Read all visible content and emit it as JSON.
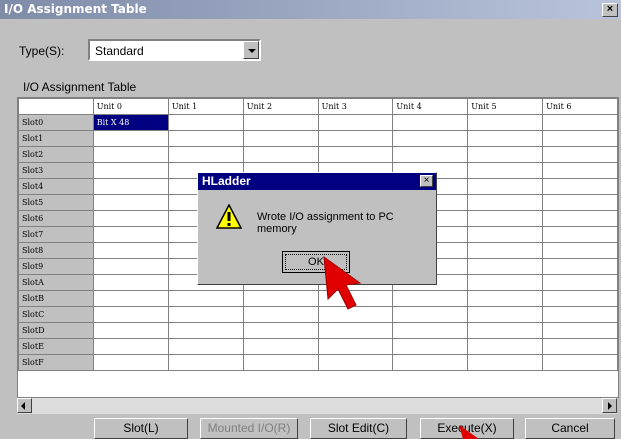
{
  "window": {
    "title": "I/O Assignment Table"
  },
  "type_field": {
    "label": "Type(S):",
    "value": "Standard"
  },
  "table": {
    "caption": "I/O Assignment Table",
    "columns": [
      "Unit 0",
      "Unit 1",
      "Unit 2",
      "Unit 3",
      "Unit 4",
      "Unit 5",
      "Unit 6"
    ],
    "rows": [
      "Slot0",
      "Slot1",
      "Slot2",
      "Slot3",
      "Slot4",
      "Slot5",
      "Slot6",
      "Slot7",
      "Slot8",
      "Slot9",
      "SlotA",
      "SlotB",
      "SlotC",
      "SlotD",
      "SlotE",
      "SlotF"
    ],
    "cells": {
      "Slot0": {
        "Unit 0": "Bit X 48"
      }
    },
    "selected_cell": {
      "row": "Slot0",
      "column": "Unit 0"
    }
  },
  "buttons": {
    "slot": "Slot(L)",
    "mounted_io": "Mounted I/O(R)",
    "slot_edit": "Slot Edit(C)",
    "execute": "Execute(X)",
    "cancel": "Cancel"
  },
  "dialog": {
    "title": "HLadder",
    "message": "Wrote I/O assignment to PC memory",
    "ok_label": "OK",
    "icon": "warning-icon"
  },
  "colors": {
    "selection": "#000080",
    "dialog_title": "#000080",
    "pointer": "#e00000"
  }
}
